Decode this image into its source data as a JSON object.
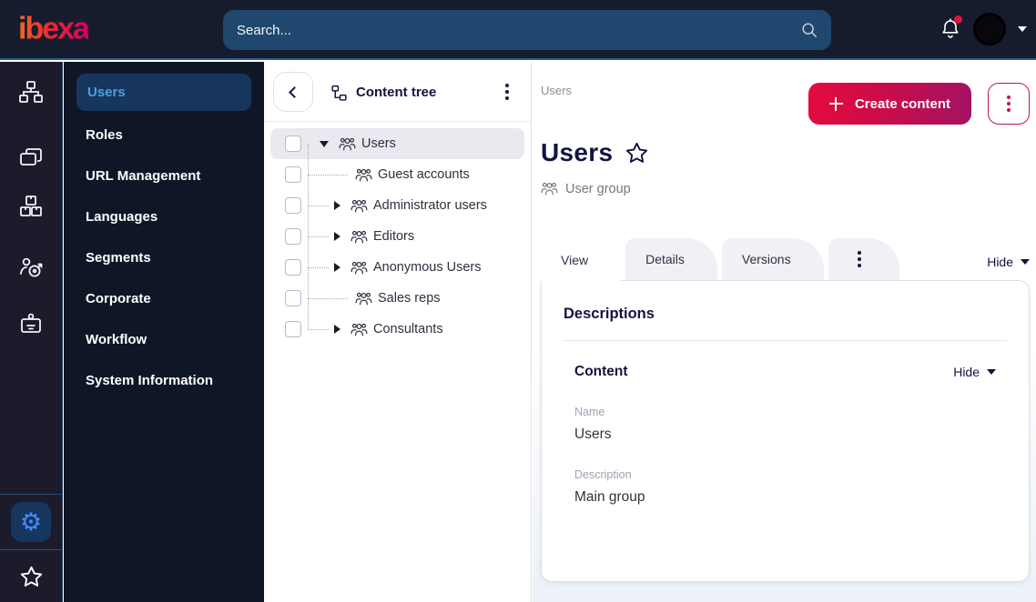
{
  "topbar": {
    "logo": "ibexa",
    "search_placeholder": "Search...",
    "notifications": {
      "has_unread": true
    }
  },
  "rail": {
    "items": [
      {
        "icon": "sitemap-icon"
      },
      {
        "icon": "pages-icon"
      },
      {
        "icon": "product-boxes-icon"
      },
      {
        "icon": "personalization-target-icon"
      },
      {
        "icon": "id-badge-icon"
      }
    ],
    "footer": [
      {
        "icon": "settings-gear-icon",
        "active": true
      },
      {
        "icon": "bookmark-star-icon",
        "active": false
      }
    ]
  },
  "sidebar": {
    "items": [
      {
        "label": "Users",
        "active": true
      },
      {
        "label": "Roles",
        "active": false
      },
      {
        "label": "URL Management",
        "active": false
      },
      {
        "label": "Languages",
        "active": false
      },
      {
        "label": "Segments",
        "active": false
      },
      {
        "label": "Corporate",
        "active": false
      },
      {
        "label": "Workflow",
        "active": false
      },
      {
        "label": "System Information",
        "active": false
      }
    ]
  },
  "content_tree": {
    "title": "Content tree",
    "items": [
      {
        "label": "Users",
        "level": 0,
        "expander": "expanded",
        "selected": true,
        "checked": false
      },
      {
        "label": "Guest accounts",
        "level": 1,
        "expander": "none",
        "selected": false,
        "checked": false
      },
      {
        "label": "Administrator users",
        "level": 1,
        "expander": "collapsed",
        "selected": false,
        "checked": false
      },
      {
        "label": "Editors",
        "level": 1,
        "expander": "collapsed",
        "selected": false,
        "checked": false
      },
      {
        "label": "Anonymous Users",
        "level": 1,
        "expander": "collapsed",
        "selected": false,
        "checked": false
      },
      {
        "label": "Sales reps",
        "level": 1,
        "expander": "none",
        "selected": false,
        "checked": false
      },
      {
        "label": "Consultants",
        "level": 1,
        "expander": "collapsed",
        "selected": false,
        "checked": false
      }
    ]
  },
  "main": {
    "breadcrumb": "Users",
    "create_button_label": "Create content",
    "title": "Users",
    "content_type": "User group",
    "tabs": [
      {
        "label": "View",
        "active": true
      },
      {
        "label": "Details",
        "active": false
      },
      {
        "label": "Versions",
        "active": false
      }
    ],
    "hide_toggle": "Hide",
    "card": {
      "section_title": "Descriptions",
      "group_title": "Content",
      "hide_toggle": "Hide",
      "fields": [
        {
          "label": "Name",
          "value": "Users"
        },
        {
          "label": "Description",
          "value": "Main group"
        }
      ]
    }
  },
  "colors": {
    "brand_red": "#db0032",
    "brand_gradient_end": "#a31263",
    "topbar_bg": "#161c2e",
    "search_bg": "#20486f",
    "rail_bg": "#1b1b2b",
    "sidebar_bg": "#0f1727",
    "active_item_bg": "#17365e",
    "active_item_text": "#4f9fe2",
    "accent_blue": "#3e8eff",
    "tree_selected_bg": "#e9e9f0"
  }
}
